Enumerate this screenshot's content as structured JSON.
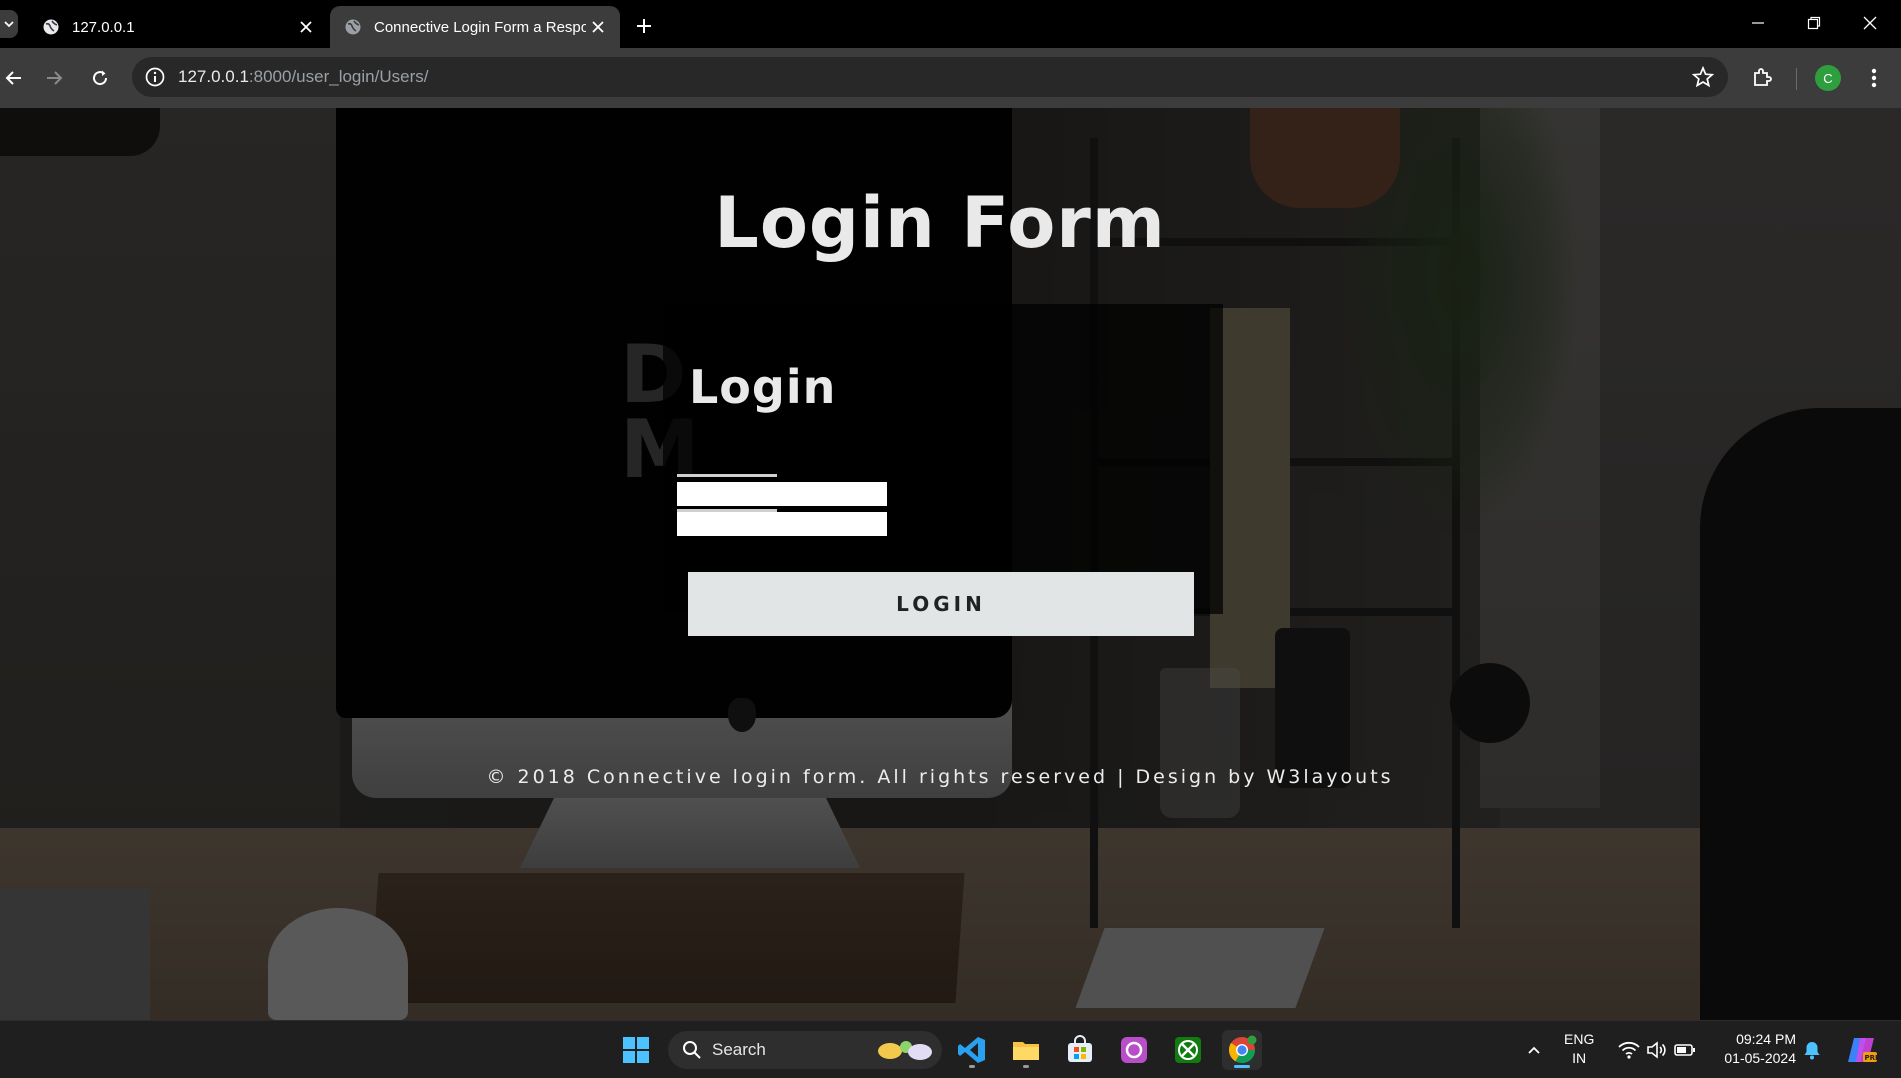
{
  "browser": {
    "tabs": [
      {
        "title": "127.0.0.1",
        "active": false
      },
      {
        "title": "Connective Login Form a Respo",
        "active": true
      }
    ],
    "url_host": "127.0.0.1",
    "url_path": ":8000/user_login/Users/",
    "profile_initial": "C"
  },
  "page": {
    "heading": "Login Form",
    "watermark": "DO\nMORE",
    "card_title": "Login",
    "username_value": "",
    "password_value": "",
    "login_button": "LOGIN",
    "footer": "© 2018 Connective login form. All rights reserved | Design by W3layouts"
  },
  "taskbar": {
    "search_placeholder": "Search",
    "language_line1": "ENG",
    "language_line2": "IN",
    "time": "09:24 PM",
    "date": "01-05-2024"
  },
  "colors": {
    "button_bg": "#e1e5e5",
    "card_bg": "rgba(0,0,0,0.72)",
    "chrome_toolbar": "#3c3c3c",
    "profile_avatar": "#2e9e3f"
  }
}
